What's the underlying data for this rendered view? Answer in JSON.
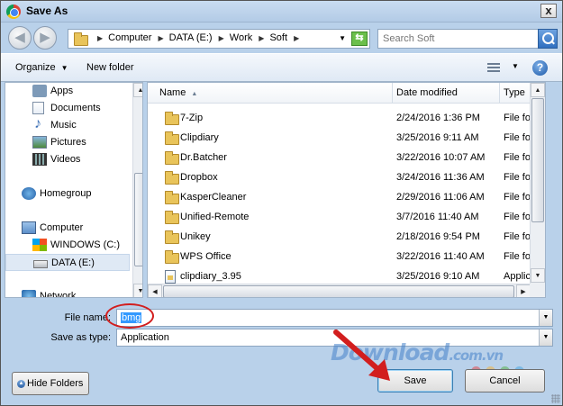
{
  "window": {
    "title": "Save As",
    "close_label": "x"
  },
  "nav_buttons": {
    "back": "◀",
    "forward": "▶"
  },
  "breadcrumb": [
    "Computer",
    "DATA (E:)",
    "Work",
    "Soft"
  ],
  "search": {
    "placeholder": "Search Soft"
  },
  "toolbar": {
    "organize": "Organize",
    "new_folder": "New folder",
    "help": "?"
  },
  "nav_pane": {
    "items": [
      {
        "label": "Apps",
        "icon": "apps-icon"
      },
      {
        "label": "Documents",
        "icon": "documents-icon"
      },
      {
        "label": "Music",
        "icon": "music-icon"
      },
      {
        "label": "Pictures",
        "icon": "pictures-icon"
      },
      {
        "label": "Videos",
        "icon": "videos-icon"
      },
      {
        "label": "Homegroup",
        "icon": "homegroup-icon"
      },
      {
        "label": "Computer",
        "icon": "computer-icon"
      },
      {
        "label": "WINDOWS (C:)",
        "icon": "windows-drive-icon"
      },
      {
        "label": "DATA (E:)",
        "icon": "drive-icon",
        "selected": true
      },
      {
        "label": "Network",
        "icon": "network-icon"
      }
    ]
  },
  "file_list": {
    "columns": [
      "Name",
      "Date modified",
      "Type"
    ],
    "rows": [
      {
        "name": "7-Zip",
        "date": "2/24/2016 1:36 PM",
        "type": "File folder"
      },
      {
        "name": "Clipdiary",
        "date": "3/25/2016 9:11 AM",
        "type": "File folder"
      },
      {
        "name": "Dr.Batcher",
        "date": "3/22/2016 10:07 AM",
        "type": "File folder"
      },
      {
        "name": "Dropbox",
        "date": "3/24/2016 11:36 AM",
        "type": "File folder"
      },
      {
        "name": "KasperCleaner",
        "date": "2/29/2016 11:06 AM",
        "type": "File folder"
      },
      {
        "name": "Unified-Remote",
        "date": "3/7/2016 11:40 AM",
        "type": "File folder"
      },
      {
        "name": "Unikey",
        "date": "2/18/2016 9:54 PM",
        "type": "File folder"
      },
      {
        "name": "WPS Office",
        "date": "3/22/2016 11:40 AM",
        "type": "File folder"
      },
      {
        "name": "clipdiary_3.95",
        "date": "3/25/2016 9:10 AM",
        "type": "Application"
      }
    ]
  },
  "file_name": {
    "label": "File name:",
    "value": "bmg"
  },
  "save_as_type": {
    "label": "Save as type:",
    "value": "Application"
  },
  "buttons": {
    "hide_folders": "Hide Folders",
    "save": "Save",
    "cancel": "Cancel"
  },
  "watermark": {
    "main": "Download",
    "suffix": ".com.vn"
  },
  "colors": {
    "accent": "#3399ff",
    "annotation": "#d21e1e",
    "frame": "#b9d1ea"
  }
}
